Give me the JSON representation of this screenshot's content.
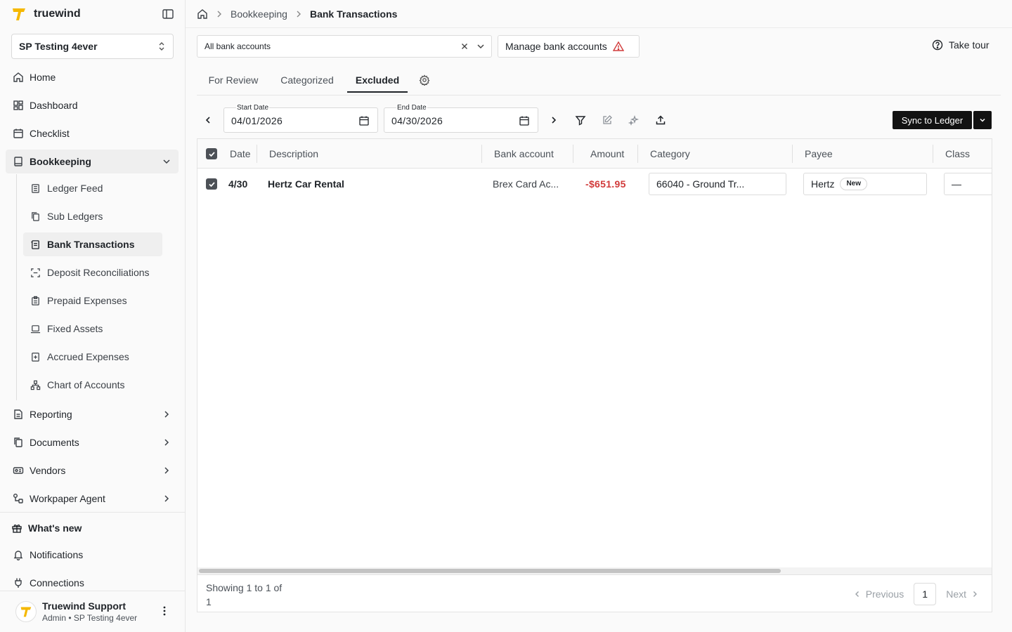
{
  "brand": {
    "name": "truewind",
    "accent": "#F5B800"
  },
  "sidebar": {
    "company": "SP Testing 4ever",
    "items": [
      {
        "label": "Home",
        "icon": "home-icon"
      },
      {
        "label": "Dashboard",
        "icon": "dashboard-icon"
      },
      {
        "label": "Checklist",
        "icon": "calendar-check-icon"
      },
      {
        "label": "Bookkeeping",
        "icon": "book-icon"
      },
      {
        "label": "Reporting",
        "icon": "report-icon"
      },
      {
        "label": "Documents",
        "icon": "documents-icon"
      },
      {
        "label": "Vendors",
        "icon": "vendor-icon"
      },
      {
        "label": "Workpaper Agent",
        "icon": "agent-icon"
      }
    ],
    "bookkeeping_sub": [
      {
        "label": "Ledger Feed"
      },
      {
        "label": "Sub Ledgers"
      },
      {
        "label": "Bank Transactions"
      },
      {
        "label": "Deposit Reconciliations"
      },
      {
        "label": "Prepaid Expenses"
      },
      {
        "label": "Fixed Assets"
      },
      {
        "label": "Accrued Expenses"
      },
      {
        "label": "Chart of Accounts"
      }
    ],
    "bottom": [
      {
        "label": "What's new"
      },
      {
        "label": "Notifications"
      },
      {
        "label": "Connections"
      }
    ],
    "user": {
      "name": "Truewind Support",
      "role": "Admin • SP Testing 4ever"
    }
  },
  "breadcrumb": {
    "parent": "Bookkeeping",
    "current": "Bank Transactions"
  },
  "toolbar": {
    "account_filter": "All bank accounts",
    "manage_label": "Manage bank accounts",
    "tour_label": "Take tour"
  },
  "tabs": [
    "For Review",
    "Categorized",
    "Excluded"
  ],
  "dates": {
    "start_label": "Start Date",
    "start_value": "04/01/2026",
    "end_label": "End Date",
    "end_value": "04/30/2026"
  },
  "sync_label": "Sync to Ledger",
  "table": {
    "columns": [
      "Date",
      "Description",
      "Bank account",
      "Amount",
      "Category",
      "Payee",
      "Class"
    ],
    "rows": [
      {
        "date": "4/30",
        "description": "Hertz Car Rental",
        "bank_account": "Brex Card Ac...",
        "amount": "-$651.95",
        "category": "66040 - Ground Tr...",
        "payee": "Hertz",
        "payee_badge": "New",
        "class": "—"
      }
    ]
  },
  "pagination": {
    "showing": "Showing 1 to 1 of 1",
    "previous": "Previous",
    "page": "1",
    "next": "Next"
  }
}
